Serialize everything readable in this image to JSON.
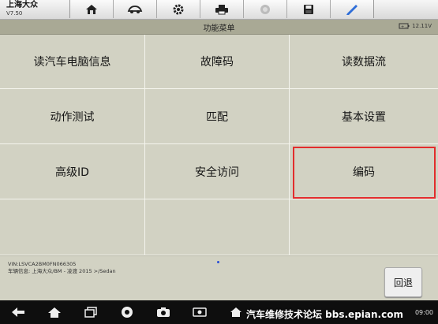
{
  "header": {
    "brand": "上海大众",
    "version": "V7.50"
  },
  "toolbar": {
    "icons": [
      "home-icon",
      "vehicle-icon",
      "gear-icon",
      "printer-icon",
      "disabled-icon",
      "save-icon",
      "pen-icon"
    ]
  },
  "titlebar": {
    "title": "功能菜单",
    "voltage": "12.11V"
  },
  "menu": {
    "r0c0": "读汽车电脑信息",
    "r0c1": "故障码",
    "r0c2": "读数据流",
    "r1c0": "动作测试",
    "r1c1": "匹配",
    "r1c2": "基本设置",
    "r2c0": "高级ID",
    "r2c1": "安全访问",
    "r2c2": "编码",
    "r3c0": "",
    "r3c1": "",
    "r3c2": ""
  },
  "info": {
    "vin": "VIN:LSVCA2BM0FN066305",
    "vehicle": "车辆信息: 上海大众/BM - 凌渡 2015 >/Sedan"
  },
  "buttons": {
    "back": "回退"
  },
  "navbar": {
    "watermark": "汽车维修技术论坛 bbs.epian.com",
    "clock": "09:00"
  },
  "colors": {
    "highlight": "#e22d2d",
    "tile": "#d2d2c3"
  }
}
